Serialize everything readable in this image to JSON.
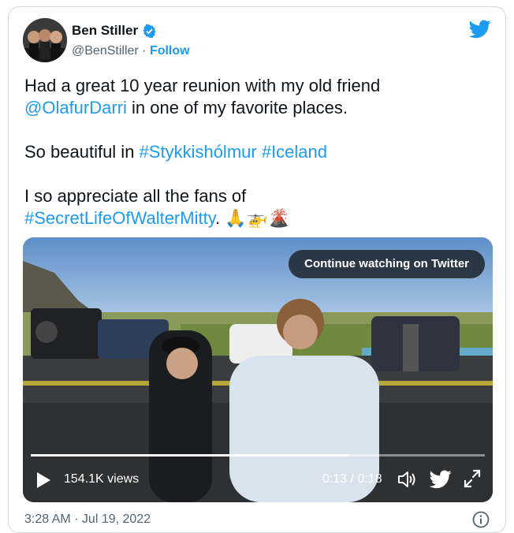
{
  "author": {
    "display_name": "Ben Stiller",
    "handle": "@BenStiller",
    "separator": " · ",
    "follow_label": "Follow"
  },
  "tweet": {
    "line1_prefix": "Had a great 10 year reunion with my old friend",
    "mention": "@OlafurDarri",
    "line2_suffix": " in one of my favorite places.",
    "line3_prefix": "So beautiful in ",
    "hashtag1": "#Stykkishólmur",
    "hashtag2": "#Iceland",
    "line4": "I so appreciate all the fans of",
    "hashtag3": "#SecretLifeOfWalterMitty",
    "line5_suffix": ". ",
    "emojis": "🙏🚁🌋"
  },
  "video": {
    "continue_label": "Continue watching on Twitter",
    "views": "154.1K views",
    "time": "0:13 / 0:18",
    "progress": 0.7
  },
  "footer": {
    "timestamp": "3:28 AM · Jul 19, 2022"
  },
  "icons": {
    "verified": "verified-badge-icon",
    "twitter": "twitter-bird-icon",
    "play": "play-icon",
    "volume": "volume-icon",
    "fullscreen": "fullscreen-icon",
    "info": "info-icon"
  },
  "colors": {
    "accent": "#1d9bf0",
    "text": "#0f1419",
    "muted": "#536471"
  }
}
